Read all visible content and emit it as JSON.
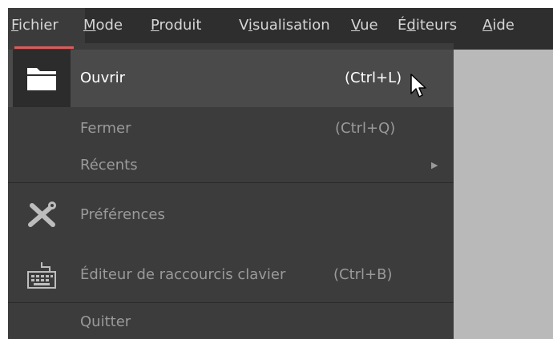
{
  "menubar": {
    "items": [
      {
        "label": "Fichier",
        "mnemonic": "F"
      },
      {
        "label": "Mode",
        "mnemonic": "M"
      },
      {
        "label": "Produit",
        "mnemonic": "P"
      },
      {
        "label": "Visualisation",
        "mnemonic": "i"
      },
      {
        "label": "Vue",
        "mnemonic": "V"
      },
      {
        "label": "Éditeurs",
        "mnemonic": "d"
      },
      {
        "label": "Aide",
        "mnemonic": "A"
      }
    ]
  },
  "file_menu": {
    "open": {
      "label": "Ouvrir",
      "shortcut": "(Ctrl+L)",
      "icon": "folder-icon"
    },
    "close": {
      "label": "Fermer",
      "shortcut": "(Ctrl+Q)"
    },
    "recent": {
      "label": "Récents",
      "submenu_indicator": "▶"
    },
    "preferences": {
      "label": "Préférences",
      "icon": "tools-icon"
    },
    "shortcut_editor": {
      "label": "Éditeur de raccourcis clavier",
      "shortcut": "(Ctrl+B)",
      "icon": "keyboard-icon"
    },
    "quit": {
      "label": "Quitter"
    }
  },
  "colors": {
    "accent": "#e05a5a",
    "menu_bg": "#3c3c3c",
    "highlight_bg": "#4a4a4a",
    "text_dim": "#9a9a9a",
    "text_bright": "#ffffff"
  }
}
